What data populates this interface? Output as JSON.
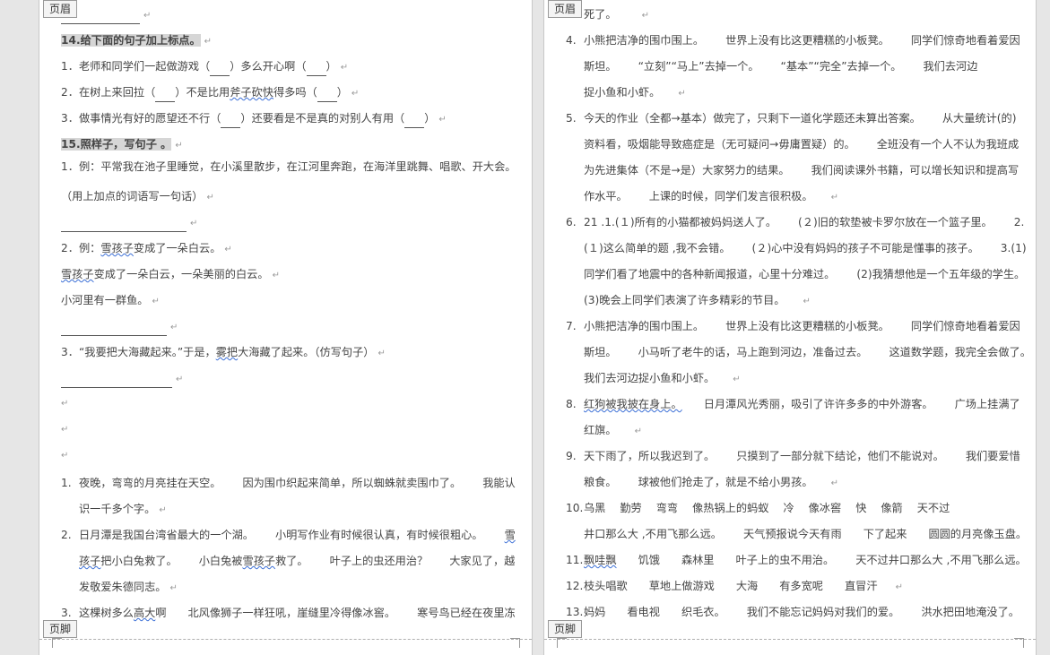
{
  "header_tag": "页眉",
  "footer_tag": "页脚",
  "left": {
    "q14_title": "14.给下面的句子加上标点。",
    "q14_1a": "1．老师和同学们一起做游戏（",
    "q14_1b": "）多么开心啊（",
    "q14_1c": "）",
    "q14_2a": "2．在树上来回拉（",
    "q14_2b": "）不是比用",
    "q14_2c": "斧子砍快",
    "q14_2d": "得多吗（",
    "q14_2e": "）",
    "q14_3a": "3．做事情光有好的愿望还不行（",
    "q14_3b": "）还要看是不是真的对别人有用（",
    "q14_3c": "）",
    "q15_title": "15.照样子，写句子 。",
    "q15_1": "1．例：平常我在池子里睡觉，在小溪里散步，在江河里奔跑，在海洋里跳舞、唱歌、开大会。",
    "q15_1_hint": "（用上加点的词语写一句话）",
    "q15_2_a": "2．例：",
    "q15_2_b": "雪孩子",
    "q15_2_c": "变成了一朵白云。",
    "q15_2_ex_a": "雪孩子",
    "q15_2_ex_b": "变成了一朵白云，一朵美丽的白云。",
    "q15_2_task": "小河里有一群鱼。",
    "q15_3_a": "3．“我要把大海藏起来。”于是，",
    "q15_3_b": "雾把",
    "q15_3_c": "大海藏了起来。（仿写句子）",
    "a1_num": "1.",
    "a1_l1": [
      "夜晚，弯弯的月亮挂在天空。",
      "因为围巾织起来简单，所以蜘蛛就卖围巾了。",
      "我能认"
    ],
    "a1_l2": "识一千多个字。",
    "a2_num": "2.",
    "a2_l1": [
      "日月潭是我国台湾省最大的一个湖。",
      "小明写作业有时候很认真，有时候很粗心。",
      "雪"
    ],
    "a2_l2a": "孩子",
    "a2_l2b": "把小白兔救了。",
    "a2_l2c": "小白兔被",
    "a2_l2d": "雪孩子",
    "a2_l2e": "救了。",
    "a2_l2f": "叶子上的虫还用治？",
    "a2_l2g": "大家见了，越",
    "a2_l3": "发敬爱朱德同志。",
    "a3_num": "3.",
    "a3_l1a": "这棵树多么",
    "a3_l1b": "高大",
    "a3_l1c": "啊",
    "a3_l1d": "北风像狮子一样狂吼，崖缝里冷得像冰窖。",
    "a3_l1e": "寒号鸟已经在夜里冻"
  },
  "right": {
    "r_top": "死了。",
    "items": [
      {
        "num": "4.",
        "lines": [
          [
            "小熊把洁净的围巾围上。",
            "世界上没有比这更糟糕的小板凳。",
            "同学们惊奇地看着爱因"
          ],
          [
            "斯坦。",
            "“立刻”“马上”去掉一个。",
            "“基本”“完全”去掉一个。",
            "我们去河边"
          ],
          [
            "捉小鱼和小虾。"
          ]
        ]
      },
      {
        "num": "5.",
        "lines": [
          [
            "今天的作业（全都→基本）做完了，只剩下一道化学题还未算出答案。",
            "从大量统计(的)"
          ],
          [
            "资料看，吸烟能导致癌症是（无可疑问→毋庸置疑）的。",
            "全班没有一个人不认为我班成"
          ],
          [
            "为先进集体（不是→是）大家努力的结果。",
            "我们阅读课外书籍，可以增长知识和提高写"
          ],
          [
            "作水平。",
            "上课的时候，同学们发言很积极。"
          ]
        ]
      },
      {
        "num": "6.",
        "lines": [
          [
            "21 .1.(１)所有的小猫都被妈妈送人了。",
            "(２)旧的软垫被卡罗尔放在一个篮子里。",
            "2."
          ],
          [
            "(１)这么简单的题 ,我不会错。",
            "(２)心中没有妈妈的孩子不可能是懂事的孩子。",
            "3.(1)"
          ],
          [
            "同学们看了地震中的各种新闻报道，心里十分难过。",
            "(2)我猜想他是一个五年级的学生。"
          ],
          [
            "(3)晚会上同学们表演了许多精彩的节目。"
          ]
        ]
      },
      {
        "num": "7.",
        "lines": [
          [
            "小熊把洁净的围巾围上。",
            "世界上没有比这更糟糕的小板凳。",
            "同学们惊奇地看着爱因"
          ],
          [
            "斯坦。",
            "小马听了老牛的话，马上跑到河边，准备过去。",
            "这道数学题，我完全会做了。"
          ],
          [
            "我们去河边捉小鱼和小虾。"
          ]
        ]
      },
      {
        "num": "8.",
        "lines": [
          [
            "红狗被我披在身上。",
            "日月潭风光秀丽，吸引了许许多多的中外游客。",
            "广场上挂满了"
          ],
          [
            "红旗。"
          ]
        ]
      },
      {
        "num": "9.",
        "lines": [
          [
            "天下雨了，所以我迟到了。",
            "只摸到了一部分就下结论，他们不能说对。",
            "我们要爱惜"
          ],
          [
            "粮食。",
            "球被他们抢走了，就是不给小男孩。"
          ]
        ]
      },
      {
        "num": "10.",
        "lines": [
          [
            "乌黑",
            "勤劳",
            "弯弯",
            "像热锅上的蚂蚁",
            "冷",
            "像冰窖",
            "快",
            "像箭",
            "天不过"
          ],
          [
            "井口那么大 ,不用飞那么远。",
            "天气预报说今天有雨",
            "下了起来",
            "圆圆的月亮像玉盘。"
          ]
        ]
      },
      {
        "num": "11.",
        "lines": [
          [
            "飘哇飘",
            "饥饿",
            "森林里",
            "叶子上的虫不用治。",
            "天不过井口那么大 ,不用飞那么远。"
          ]
        ]
      },
      {
        "num": "12.",
        "lines": [
          [
            "枝头唱歌",
            "草地上做游戏",
            "大海",
            "有多宽呢",
            "直冒汗"
          ]
        ]
      },
      {
        "num": "13.",
        "lines": [
          [
            "妈妈",
            "看电视",
            "织毛衣。",
            "我们不能忘记妈妈对我们的爱。",
            "洪水把田地淹没了。"
          ]
        ]
      }
    ]
  }
}
